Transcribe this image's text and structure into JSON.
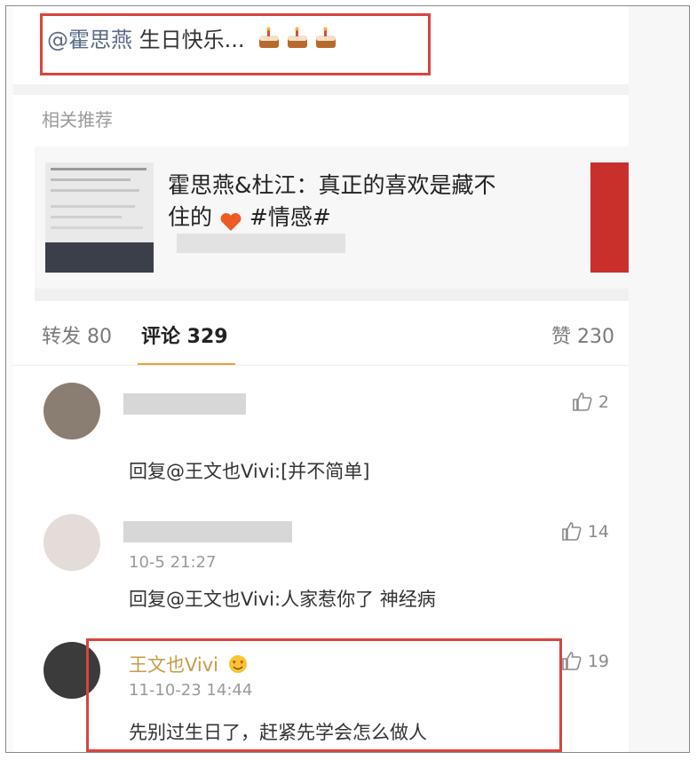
{
  "post": {
    "mention": "@霍思燕",
    "text": "生日快乐...",
    "emoji": "cake-emoji"
  },
  "related": {
    "label": "相关推荐",
    "card_title_1": "霍思燕&杜江：真正的喜欢是藏不",
    "card_title_2": "住的",
    "card_tag": "#情感#"
  },
  "tabs": {
    "repost": "转发 80",
    "comment": "评论 329",
    "like": "赞 230"
  },
  "comments": [
    {
      "time": "",
      "text": "回复@王文也Vivi:[并不简单]",
      "likes": "2"
    },
    {
      "time": "10-5 21:27",
      "text": "回复@王文也Vivi:人家惹你了 神经病",
      "likes": "14"
    },
    {
      "username": "王文也Vivi",
      "time": "11-10-23 14:44",
      "text": "先别过生日了，赶紧先学会怎么做人",
      "likes": "19"
    }
  ],
  "colors": {
    "highlight_box": "#d9443d",
    "tab_underline": "#e8a43a",
    "username": "#c89a45"
  }
}
